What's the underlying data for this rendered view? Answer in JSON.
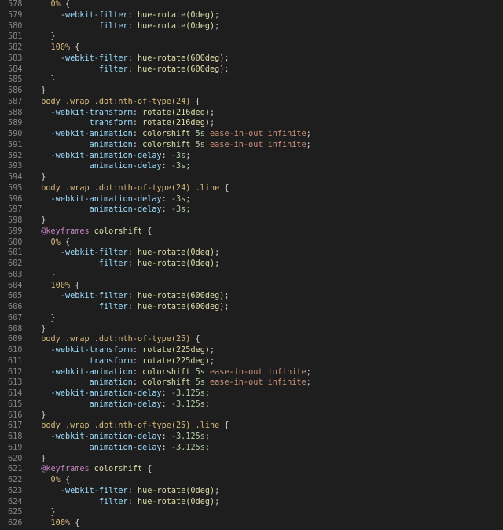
{
  "editor": {
    "colors": {
      "background": "#1e1e1e",
      "gutter": "#858585",
      "selector": "#d7ba7d",
      "property": "#9cdcfe",
      "value": "#ce9178",
      "number": "#b5cea8",
      "keyword": "#c586c0",
      "punctuation": "#d4d4d4"
    },
    "lines": [
      {
        "n": "578",
        "tokens": [
          [
            "    ",
            "punc"
          ],
          [
            "0%",
            "pct"
          ],
          [
            " {",
            "punc"
          ]
        ]
      },
      {
        "n": "579",
        "tokens": [
          [
            "      ",
            "punc"
          ],
          [
            "-webkit-filter",
            "prop"
          ],
          [
            ": ",
            "punc"
          ],
          [
            "hue-rotate(0deg)",
            "fn"
          ],
          [
            ";",
            "punc"
          ]
        ]
      },
      {
        "n": "580",
        "tokens": [
          [
            "              ",
            "punc"
          ],
          [
            "filter",
            "prop"
          ],
          [
            ": ",
            "punc"
          ],
          [
            "hue-rotate(0deg)",
            "fn"
          ],
          [
            ";",
            "punc"
          ]
        ]
      },
      {
        "n": "581",
        "tokens": [
          [
            "    ",
            "punc"
          ],
          [
            "}",
            "punc"
          ]
        ]
      },
      {
        "n": "582",
        "tokens": [
          [
            "    ",
            "punc"
          ],
          [
            "100%",
            "pct"
          ],
          [
            " {",
            "punc"
          ]
        ]
      },
      {
        "n": "583",
        "tokens": [
          [
            "      ",
            "punc"
          ],
          [
            "-webkit-filter",
            "prop"
          ],
          [
            ": ",
            "punc"
          ],
          [
            "hue-rotate(600deg)",
            "fn"
          ],
          [
            ";",
            "punc"
          ]
        ]
      },
      {
        "n": "584",
        "tokens": [
          [
            "              ",
            "punc"
          ],
          [
            "filter",
            "prop"
          ],
          [
            ": ",
            "punc"
          ],
          [
            "hue-rotate(600deg)",
            "fn"
          ],
          [
            ";",
            "punc"
          ]
        ]
      },
      {
        "n": "585",
        "tokens": [
          [
            "    ",
            "punc"
          ],
          [
            "}",
            "punc"
          ]
        ]
      },
      {
        "n": "586",
        "tokens": [
          [
            "  ",
            "punc"
          ],
          [
            "}",
            "punc"
          ]
        ]
      },
      {
        "n": "587",
        "tokens": [
          [
            "  ",
            "punc"
          ],
          [
            "body .wrap .dot:nth-of-type(24)",
            "sel"
          ],
          [
            " {",
            "punc"
          ]
        ]
      },
      {
        "n": "588",
        "tokens": [
          [
            "    ",
            "punc"
          ],
          [
            "-webkit-transform",
            "prop"
          ],
          [
            ": ",
            "punc"
          ],
          [
            "rotate(216deg)",
            "fn"
          ],
          [
            ";",
            "punc"
          ]
        ]
      },
      {
        "n": "589",
        "tokens": [
          [
            "            ",
            "punc"
          ],
          [
            "transform",
            "prop"
          ],
          [
            ": ",
            "punc"
          ],
          [
            "rotate(216deg)",
            "fn"
          ],
          [
            ";",
            "punc"
          ]
        ]
      },
      {
        "n": "590",
        "tokens": [
          [
            "    ",
            "punc"
          ],
          [
            "-webkit-animation",
            "prop"
          ],
          [
            ": ",
            "punc"
          ],
          [
            "colorshift",
            "fn"
          ],
          [
            " ",
            "punc"
          ],
          [
            "5s",
            "num"
          ],
          [
            " ",
            "punc"
          ],
          [
            "ease-in-out infinite",
            "val"
          ],
          [
            ";",
            "punc"
          ]
        ]
      },
      {
        "n": "591",
        "tokens": [
          [
            "            ",
            "punc"
          ],
          [
            "animation",
            "prop"
          ],
          [
            ": ",
            "punc"
          ],
          [
            "colorshift",
            "fn"
          ],
          [
            " ",
            "punc"
          ],
          [
            "5s",
            "num"
          ],
          [
            " ",
            "punc"
          ],
          [
            "ease-in-out infinite",
            "val"
          ],
          [
            ";",
            "punc"
          ]
        ]
      },
      {
        "n": "592",
        "tokens": [
          [
            "    ",
            "punc"
          ],
          [
            "-webkit-animation-delay",
            "prop"
          ],
          [
            ": ",
            "punc"
          ],
          [
            "-3s",
            "num"
          ],
          [
            ";",
            "punc"
          ]
        ]
      },
      {
        "n": "593",
        "tokens": [
          [
            "            ",
            "punc"
          ],
          [
            "animation-delay",
            "prop"
          ],
          [
            ": ",
            "punc"
          ],
          [
            "-3s",
            "num"
          ],
          [
            ";",
            "punc"
          ]
        ]
      },
      {
        "n": "594",
        "tokens": [
          [
            "  ",
            "punc"
          ],
          [
            "}",
            "punc"
          ]
        ]
      },
      {
        "n": "595",
        "tokens": [
          [
            "  ",
            "punc"
          ],
          [
            "body .wrap .dot:nth-of-type(24) .line",
            "sel"
          ],
          [
            " {",
            "punc"
          ]
        ]
      },
      {
        "n": "596",
        "tokens": [
          [
            "    ",
            "punc"
          ],
          [
            "-webkit-animation-delay",
            "prop"
          ],
          [
            ": ",
            "punc"
          ],
          [
            "-3s",
            "num"
          ],
          [
            ";",
            "punc"
          ]
        ]
      },
      {
        "n": "597",
        "tokens": [
          [
            "            ",
            "punc"
          ],
          [
            "animation-delay",
            "prop"
          ],
          [
            ": ",
            "punc"
          ],
          [
            "-3s",
            "num"
          ],
          [
            ";",
            "punc"
          ]
        ]
      },
      {
        "n": "598",
        "tokens": [
          [
            "  ",
            "punc"
          ],
          [
            "}",
            "punc"
          ]
        ]
      },
      {
        "n": "599",
        "tokens": [
          [
            "  ",
            "punc"
          ],
          [
            "@keyframes",
            "kw"
          ],
          [
            " ",
            "punc"
          ],
          [
            "colorshift",
            "fn"
          ],
          [
            " {",
            "punc"
          ]
        ]
      },
      {
        "n": "600",
        "tokens": [
          [
            "    ",
            "punc"
          ],
          [
            "0%",
            "pct"
          ],
          [
            " {",
            "punc"
          ]
        ]
      },
      {
        "n": "601",
        "tokens": [
          [
            "      ",
            "punc"
          ],
          [
            "-webkit-filter",
            "prop"
          ],
          [
            ": ",
            "punc"
          ],
          [
            "hue-rotate(0deg)",
            "fn"
          ],
          [
            ";",
            "punc"
          ]
        ]
      },
      {
        "n": "602",
        "tokens": [
          [
            "              ",
            "punc"
          ],
          [
            "filter",
            "prop"
          ],
          [
            ": ",
            "punc"
          ],
          [
            "hue-rotate(0deg)",
            "fn"
          ],
          [
            ";",
            "punc"
          ]
        ]
      },
      {
        "n": "603",
        "tokens": [
          [
            "    ",
            "punc"
          ],
          [
            "}",
            "punc"
          ]
        ]
      },
      {
        "n": "604",
        "tokens": [
          [
            "    ",
            "punc"
          ],
          [
            "100%",
            "pct"
          ],
          [
            " {",
            "punc"
          ]
        ]
      },
      {
        "n": "605",
        "tokens": [
          [
            "      ",
            "punc"
          ],
          [
            "-webkit-filter",
            "prop"
          ],
          [
            ": ",
            "punc"
          ],
          [
            "hue-rotate(600deg)",
            "fn"
          ],
          [
            ";",
            "punc"
          ]
        ]
      },
      {
        "n": "606",
        "tokens": [
          [
            "              ",
            "punc"
          ],
          [
            "filter",
            "prop"
          ],
          [
            ": ",
            "punc"
          ],
          [
            "hue-rotate(600deg)",
            "fn"
          ],
          [
            ";",
            "punc"
          ]
        ]
      },
      {
        "n": "607",
        "tokens": [
          [
            "    ",
            "punc"
          ],
          [
            "}",
            "punc"
          ]
        ]
      },
      {
        "n": "608",
        "tokens": [
          [
            "  ",
            "punc"
          ],
          [
            "}",
            "punc"
          ]
        ]
      },
      {
        "n": "609",
        "tokens": [
          [
            "  ",
            "punc"
          ],
          [
            "body .wrap .dot:nth-of-type(25)",
            "sel"
          ],
          [
            " {",
            "punc"
          ]
        ]
      },
      {
        "n": "610",
        "tokens": [
          [
            "    ",
            "punc"
          ],
          [
            "-webkit-transform",
            "prop"
          ],
          [
            ": ",
            "punc"
          ],
          [
            "rotate(225deg)",
            "fn"
          ],
          [
            ";",
            "punc"
          ]
        ]
      },
      {
        "n": "611",
        "tokens": [
          [
            "            ",
            "punc"
          ],
          [
            "transform",
            "prop"
          ],
          [
            ": ",
            "punc"
          ],
          [
            "rotate(225deg)",
            "fn"
          ],
          [
            ";",
            "punc"
          ]
        ]
      },
      {
        "n": "612",
        "tokens": [
          [
            "    ",
            "punc"
          ],
          [
            "-webkit-animation",
            "prop"
          ],
          [
            ": ",
            "punc"
          ],
          [
            "colorshift",
            "fn"
          ],
          [
            " ",
            "punc"
          ],
          [
            "5s",
            "num"
          ],
          [
            " ",
            "punc"
          ],
          [
            "ease-in-out infinite",
            "val"
          ],
          [
            ";",
            "punc"
          ]
        ]
      },
      {
        "n": "613",
        "tokens": [
          [
            "            ",
            "punc"
          ],
          [
            "animation",
            "prop"
          ],
          [
            ": ",
            "punc"
          ],
          [
            "colorshift",
            "fn"
          ],
          [
            " ",
            "punc"
          ],
          [
            "5s",
            "num"
          ],
          [
            " ",
            "punc"
          ],
          [
            "ease-in-out infinite",
            "val"
          ],
          [
            ";",
            "punc"
          ]
        ]
      },
      {
        "n": "614",
        "tokens": [
          [
            "    ",
            "punc"
          ],
          [
            "-webkit-animation-delay",
            "prop"
          ],
          [
            ": ",
            "punc"
          ],
          [
            "-3.125s",
            "num"
          ],
          [
            ";",
            "punc"
          ]
        ]
      },
      {
        "n": "615",
        "tokens": [
          [
            "            ",
            "punc"
          ],
          [
            "animation-delay",
            "prop"
          ],
          [
            ": ",
            "punc"
          ],
          [
            "-3.125s",
            "num"
          ],
          [
            ";",
            "punc"
          ]
        ]
      },
      {
        "n": "616",
        "tokens": [
          [
            "  ",
            "punc"
          ],
          [
            "}",
            "punc"
          ]
        ]
      },
      {
        "n": "617",
        "tokens": [
          [
            "  ",
            "punc"
          ],
          [
            "body .wrap .dot:nth-of-type(25) .line",
            "sel"
          ],
          [
            " {",
            "punc"
          ]
        ]
      },
      {
        "n": "618",
        "tokens": [
          [
            "    ",
            "punc"
          ],
          [
            "-webkit-animation-delay",
            "prop"
          ],
          [
            ": ",
            "punc"
          ],
          [
            "-3.125s",
            "num"
          ],
          [
            ";",
            "punc"
          ]
        ]
      },
      {
        "n": "619",
        "tokens": [
          [
            "            ",
            "punc"
          ],
          [
            "animation-delay",
            "prop"
          ],
          [
            ": ",
            "punc"
          ],
          [
            "-3.125s",
            "num"
          ],
          [
            ";",
            "punc"
          ]
        ]
      },
      {
        "n": "620",
        "tokens": [
          [
            "  ",
            "punc"
          ],
          [
            "}",
            "punc"
          ]
        ]
      },
      {
        "n": "621",
        "tokens": [
          [
            "  ",
            "punc"
          ],
          [
            "@keyframes",
            "kw"
          ],
          [
            " ",
            "punc"
          ],
          [
            "colorshift",
            "fn"
          ],
          [
            " {",
            "punc"
          ]
        ]
      },
      {
        "n": "622",
        "tokens": [
          [
            "    ",
            "punc"
          ],
          [
            "0%",
            "pct"
          ],
          [
            " {",
            "punc"
          ]
        ]
      },
      {
        "n": "623",
        "tokens": [
          [
            "      ",
            "punc"
          ],
          [
            "-webkit-filter",
            "prop"
          ],
          [
            ": ",
            "punc"
          ],
          [
            "hue-rotate(0deg)",
            "fn"
          ],
          [
            ";",
            "punc"
          ]
        ]
      },
      {
        "n": "624",
        "tokens": [
          [
            "              ",
            "punc"
          ],
          [
            "filter",
            "prop"
          ],
          [
            ": ",
            "punc"
          ],
          [
            "hue-rotate(0deg)",
            "fn"
          ],
          [
            ";",
            "punc"
          ]
        ]
      },
      {
        "n": "625",
        "tokens": [
          [
            "    ",
            "punc"
          ],
          [
            "}",
            "punc"
          ]
        ]
      },
      {
        "n": "626",
        "tokens": [
          [
            "    ",
            "punc"
          ],
          [
            "100%",
            "pct"
          ],
          [
            " {",
            "punc"
          ]
        ]
      }
    ]
  }
}
